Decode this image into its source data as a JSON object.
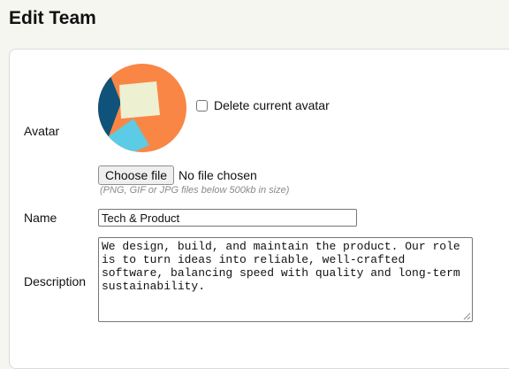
{
  "page": {
    "title": "Edit Team"
  },
  "form": {
    "avatar": {
      "label": "Avatar",
      "image_icon": "team-avatar-image",
      "colors": {
        "main": "#f98644",
        "dark": "#0f527a",
        "light": "#5ccbe5",
        "paper": "#eef0d2"
      },
      "delete_label": "Delete current avatar",
      "delete_checked": false
    },
    "file": {
      "button_label": "Choose file",
      "status_text": "No file chosen",
      "hint": "(PNG, GIF or JPG files below 500kb in size)"
    },
    "name": {
      "label": "Name",
      "value": "Tech & Product"
    },
    "description": {
      "label": "Description",
      "value": "We design, build, and maintain the product. Our role is to turn ideas into reliable, well-crafted software, balancing speed with quality and long-term sustainability."
    }
  }
}
